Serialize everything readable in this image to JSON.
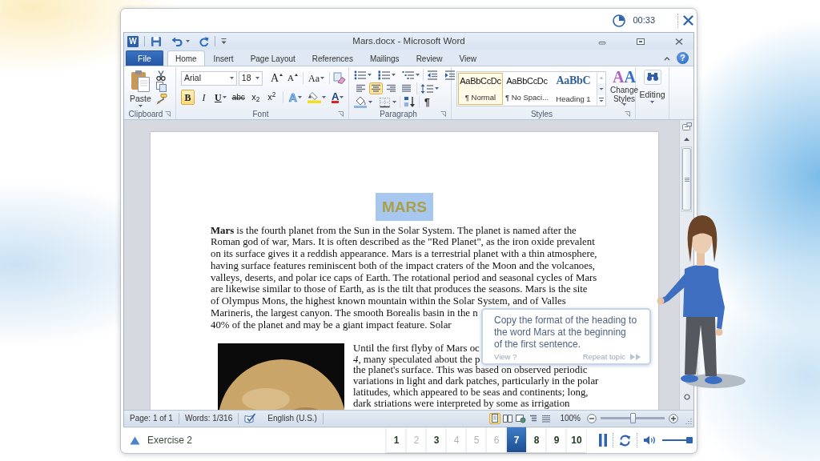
{
  "top_bar": {
    "timer": "00:33"
  },
  "window": {
    "icon_letter": "W",
    "title": "Mars.docx - Microsoft Word",
    "help": "?"
  },
  "tabs": [
    {
      "label": "File",
      "kind": "file",
      "selected": false
    },
    {
      "label": "Home",
      "kind": "tab",
      "selected": true
    },
    {
      "label": "Insert",
      "kind": "tab",
      "selected": false
    },
    {
      "label": "Page Layout",
      "kind": "tab",
      "selected": false
    },
    {
      "label": "References",
      "kind": "tab",
      "selected": false
    },
    {
      "label": "Mailings",
      "kind": "tab",
      "selected": false
    },
    {
      "label": "Review",
      "kind": "tab",
      "selected": false
    },
    {
      "label": "View",
      "kind": "tab",
      "selected": false
    }
  ],
  "ribbon": {
    "clipboard": {
      "label": "Clipboard",
      "paste": "Paste"
    },
    "font": {
      "label": "Font",
      "font_name": "Arial",
      "font_size": "18",
      "row_1": [
        {
          "kind": "grow",
          "label": "A"
        },
        {
          "kind": "shrink",
          "label": "A"
        },
        {
          "kind": "case",
          "label": "Aa",
          "menu": true
        }
      ],
      "row_2": [
        {
          "kind": "bold",
          "label": "B",
          "selected": true
        },
        {
          "kind": "italic",
          "label": "I",
          "selected": false
        },
        {
          "kind": "underline",
          "label": "U",
          "selected": false,
          "menu": true
        },
        {
          "kind": "strikethrough",
          "label": "abc",
          "selected": false
        },
        {
          "kind": "subscript",
          "label": "x$_{2}$",
          "selected": false
        },
        {
          "kind": "superscript",
          "label": "x$^{2}$",
          "selected": false
        },
        {
          "kind": "effects",
          "label": "A",
          "menu": true
        },
        {
          "kind": "highlight",
          "menu": true
        },
        {
          "kind": "color",
          "label": "A",
          "menu": true
        }
      ]
    },
    "paragraph": {
      "label": "Paragraph",
      "alignment": [
        {
          "kind": "left",
          "selected": false
        },
        {
          "kind": "center",
          "selected": true
        },
        {
          "kind": "right",
          "selected": false
        },
        {
          "kind": "justify",
          "selected": false
        }
      ],
      "pilcrow": {
        "label": "¶",
        "selected": false
      }
    },
    "styles": {
      "label": "Styles",
      "gallery": [
        {
          "kind": "body",
          "sample": "AaBbCcDc",
          "name": "¶ Normal",
          "selected": true
        },
        {
          "kind": "body",
          "sample": "AaBbCcDc",
          "name": "¶ No Spaci...",
          "selected": false
        },
        {
          "kind": "heading",
          "sample": "AaBbC",
          "name": "Heading 1",
          "selected": false
        }
      ],
      "change_styles": {
        "glyph": "AA",
        "label": "Change Styles"
      }
    },
    "editing": {
      "label": "Editing"
    }
  },
  "document": {
    "heading": {
      "text": "MARS",
      "selected": true
    },
    "paragraphs": [
      {
        "kind": "text",
        "lines": [
          "**Mars** is the fourth planet from the Sun in the Solar System. The planet is named after the",
          "Roman god of war, Mars. It is often described as the \"Red Planet\", as the iron oxide prevalent",
          "on its surface gives it a reddish appearance. Mars is a terrestrial planet with a thin atmosphere,",
          "having surface features reminiscent both of the impact craters of the Moon and the volcanoes,",
          "valleys, deserts, and polar ice caps of Earth. The rotational period and seasonal cycles of Mars",
          "are likewise similar to those of Earth, as is the tilt that produces the seasons. Mars is the site",
          "of Olympus Mons, the highest known mountain within the Solar System, and of Valles",
          "Marineris, the largest canyon. The smooth Borealis basin in the n",
          "40% of the planet and may be a giant impact feature. Solar"
        ]
      },
      {
        "kind": "image_left",
        "lines": [
          "Until the first flyby of Mars oc",
          "*4*, many speculated about the p",
          "the planet's surface. This was based on observed periodic",
          "variations in light and dark patches, particularly in the polar",
          "latitudes, which appeared to be seas and continents; long,",
          "dark striations were interpreted by some as irrigation"
        ]
      }
    ]
  },
  "callout": {
    "lines": [
      "Copy the format of the heading to",
      "the word Mars at the beginning",
      "of the first sentence."
    ],
    "view": "View ?",
    "repeat": "Repeat topic"
  },
  "status_bar": {
    "page": "Page: 1 of 1",
    "words": "Words: 1/316",
    "language": "English (U.S.)",
    "views": [
      {
        "kind": "print",
        "selected": true
      },
      {
        "kind": "reading",
        "selected": false
      },
      {
        "kind": "web",
        "selected": false
      },
      {
        "kind": "outline",
        "selected": false
      },
      {
        "kind": "draft",
        "selected": false
      }
    ],
    "zoom": "100%",
    "zoom_slider": {
      "level": 0.5
    }
  },
  "player": {
    "exercise": "Exercise 2",
    "steps": [
      {
        "label": "1",
        "selected": false,
        "disabled": false
      },
      {
        "label": "2",
        "selected": false,
        "disabled": true
      },
      {
        "label": "3",
        "selected": false,
        "disabled": false
      },
      {
        "label": "4",
        "selected": false,
        "disabled": true
      },
      {
        "label": "5",
        "selected": false,
        "disabled": true
      },
      {
        "label": "6",
        "selected": false,
        "disabled": true
      },
      {
        "label": "7",
        "selected": true,
        "disabled": false
      },
      {
        "label": "8",
        "selected": false,
        "disabled": false
      },
      {
        "label": "9",
        "selected": false,
        "disabled": false
      },
      {
        "label": "10",
        "selected": false,
        "disabled": false
      }
    ],
    "volume": {
      "level": 0.9
    }
  }
}
